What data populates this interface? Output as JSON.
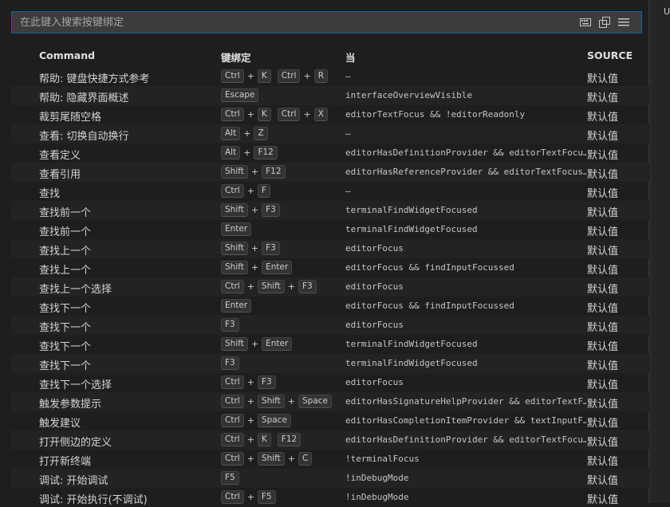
{
  "search": {
    "placeholder": "在此键入搜索按键绑定"
  },
  "search_icons": [
    "keyboard-icon",
    "record-keys-icon",
    "sort-precedence-icon"
  ],
  "side_text": "U",
  "columns": {
    "command": "Command",
    "keybinding": "键绑定",
    "when": "当",
    "source": "SOURCE"
  },
  "rows": [
    {
      "command": "帮助: 键盘快捷方式参考",
      "keys": [
        [
          "Ctrl",
          "K"
        ],
        [
          "Ctrl",
          "R"
        ]
      ],
      "when": "—",
      "source": "默认值"
    },
    {
      "command": "帮助: 隐藏界面概述",
      "keys": [
        [
          "Escape"
        ]
      ],
      "when": "interfaceOverviewVisible",
      "source": "默认值"
    },
    {
      "command": "裁剪尾随空格",
      "keys": [
        [
          "Ctrl",
          "K"
        ],
        [
          "Ctrl",
          "X"
        ]
      ],
      "when": "editorTextFocus && !editorReadonly",
      "source": "默认值"
    },
    {
      "command": "查看: 切换自动换行",
      "keys": [
        [
          "Alt",
          "Z"
        ]
      ],
      "when": "—",
      "source": "默认值"
    },
    {
      "command": "查看定义",
      "keys": [
        [
          "Alt",
          "F12"
        ]
      ],
      "when": "editorHasDefinitionProvider && editorTextFocu…",
      "source": "默认值"
    },
    {
      "command": "查看引用",
      "keys": [
        [
          "Shift",
          "F12"
        ]
      ],
      "when": "editorHasReferenceProvider && editorTextFocus…",
      "source": "默认值"
    },
    {
      "command": "查找",
      "keys": [
        [
          "Ctrl",
          "F"
        ]
      ],
      "when": "—",
      "source": "默认值"
    },
    {
      "command": "查找前一个",
      "keys": [
        [
          "Shift",
          "F3"
        ]
      ],
      "when": "terminalFindWidgetFocused",
      "source": "默认值"
    },
    {
      "command": "查找前一个",
      "keys": [
        [
          "Enter"
        ]
      ],
      "when": "terminalFindWidgetFocused",
      "source": "默认值"
    },
    {
      "command": "查找上一个",
      "keys": [
        [
          "Shift",
          "F3"
        ]
      ],
      "when": "editorFocus",
      "source": "默认值"
    },
    {
      "command": "查找上一个",
      "keys": [
        [
          "Shift",
          "Enter"
        ]
      ],
      "when": "editorFocus && findInputFocussed",
      "source": "默认值"
    },
    {
      "command": "查找上一个选择",
      "keys": [
        [
          "Ctrl",
          "Shift",
          "F3"
        ]
      ],
      "when": "editorFocus",
      "source": "默认值"
    },
    {
      "command": "查找下一个",
      "keys": [
        [
          "Enter"
        ]
      ],
      "when": "editorFocus && findInputFocussed",
      "source": "默认值"
    },
    {
      "command": "查找下一个",
      "keys": [
        [
          "F3"
        ]
      ],
      "when": "editorFocus",
      "source": "默认值"
    },
    {
      "command": "查找下一个",
      "keys": [
        [
          "Shift",
          "Enter"
        ]
      ],
      "when": "terminalFindWidgetFocused",
      "source": "默认值"
    },
    {
      "command": "查找下一个",
      "keys": [
        [
          "F3"
        ]
      ],
      "when": "terminalFindWidgetFocused",
      "source": "默认值"
    },
    {
      "command": "查找下一个选择",
      "keys": [
        [
          "Ctrl",
          "F3"
        ]
      ],
      "when": "editorFocus",
      "source": "默认值"
    },
    {
      "command": "触发参数提示",
      "keys": [
        [
          "Ctrl",
          "Shift",
          "Space"
        ]
      ],
      "when": "editorHasSignatureHelpProvider && editorTextF…",
      "source": "默认值"
    },
    {
      "command": "触发建议",
      "keys": [
        [
          "Ctrl",
          "Space"
        ]
      ],
      "when": "editorHasCompletionItemProvider && textInputF…",
      "source": "默认值"
    },
    {
      "command": "打开侧边的定义",
      "keys": [
        [
          "Ctrl",
          "K"
        ],
        [
          "F12"
        ]
      ],
      "when": "editorHasDefinitionProvider && editorTextFocu…",
      "source": "默认值"
    },
    {
      "command": "打开新终端",
      "keys": [
        [
          "Ctrl",
          "Shift",
          "C"
        ]
      ],
      "when": "!terminalFocus",
      "source": "默认值"
    },
    {
      "command": "调试: 开始调试",
      "keys": [
        [
          "F5"
        ]
      ],
      "when": "!inDebugMode",
      "source": "默认值"
    },
    {
      "command": "调试: 开始执行(不调试)",
      "keys": [
        [
          "Ctrl",
          "F5"
        ]
      ],
      "when": "!inDebugMode",
      "source": "默认值"
    }
  ]
}
